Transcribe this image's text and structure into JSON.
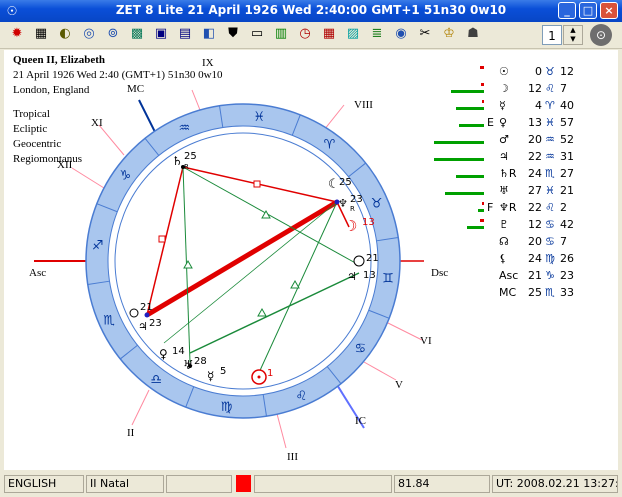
{
  "window": {
    "title": "ZET 8 Lite    21 April 1926  Wed    2:40:00 GMT+1 51n30  0w10",
    "minimize": "_",
    "maximize": "□",
    "close": "×"
  },
  "toolbar": {
    "spinner_value": "1"
  },
  "chart_header": {
    "name": "Queen II, Elizabeth",
    "datetime": "21 April 1926  Wed   2:40 (GMT+1) 51n30  0w10",
    "place": "London, England"
  },
  "chart_system": [
    "Tropical",
    "Ecliptic",
    "Geocentric",
    "Regiomontanus"
  ],
  "axis_labels": {
    "asc": "Asc",
    "dsc": "Dsc",
    "mc": "MC",
    "ic": "IC"
  },
  "house_labels": [
    "II",
    "III",
    "V",
    "VI",
    "VIII",
    "IX",
    "XI",
    "XII"
  ],
  "planet_table": [
    {
      "glyph": "☉",
      "deg": "0",
      "sign": "♉",
      "min": "12",
      "flag": "",
      "bar_green": 0,
      "bar_red": 0.3
    },
    {
      "glyph": "☽",
      "deg": "12",
      "sign": "♌",
      "min": "7",
      "flag": "",
      "bar_green": 0.6,
      "bar_red": 0.2
    },
    {
      "glyph": "☿",
      "deg": "4",
      "sign": "♈",
      "min": "40",
      "flag": "",
      "bar_green": 0.5,
      "bar_red": 0.15
    },
    {
      "glyph": "♀",
      "deg": "13",
      "sign": "♓",
      "min": "57",
      "flag": "E",
      "bar_green": 0.45,
      "bar_red": 0
    },
    {
      "glyph": "♂",
      "deg": "20",
      "sign": "♒",
      "min": "52",
      "flag": "",
      "bar_green": 0.9,
      "bar_red": 0
    },
    {
      "glyph": "♃",
      "deg": "22",
      "sign": "♒",
      "min": "31",
      "flag": "",
      "bar_green": 0.9,
      "bar_red": 0
    },
    {
      "glyph": "♄R",
      "deg": "24",
      "sign": "♏",
      "min": "27",
      "flag": "",
      "bar_green": 0.5,
      "bar_red": 0
    },
    {
      "glyph": "♅",
      "deg": "27",
      "sign": "♓",
      "min": "21",
      "flag": "",
      "bar_green": 0.7,
      "bar_red": 0
    },
    {
      "glyph": "♆R",
      "deg": "22",
      "sign": "♌",
      "min": "2",
      "flag": "F",
      "bar_green": 0.1,
      "bar_red": 0.15
    },
    {
      "glyph": "♇",
      "deg": "12",
      "sign": "♋",
      "min": "42",
      "flag": "",
      "bar_green": 0.3,
      "bar_red": 0.3
    },
    {
      "glyph": "☊",
      "deg": "20",
      "sign": "♋",
      "min": "7",
      "flag": "",
      "bar_green": 0,
      "bar_red": 0
    },
    {
      "glyph": "⚸",
      "deg": "24",
      "sign": "♍",
      "min": "26",
      "flag": "",
      "bar_green": 0,
      "bar_red": 0
    },
    {
      "glyph": "Asc",
      "deg": "21",
      "sign": "♑",
      "min": "23",
      "flag": "",
      "bar_green": 0,
      "bar_red": 0
    },
    {
      "glyph": "MC",
      "deg": "25",
      "sign": "♏",
      "min": "33",
      "flag": "",
      "bar_green": 0,
      "bar_red": 0
    }
  ],
  "wheel_planets": [
    {
      "glyph": "♄",
      "label": "25",
      "sub": "R"
    },
    {
      "glyph": "☾",
      "label": "25"
    },
    {
      "glyph": "♆",
      "label": "23",
      "sub": "R"
    },
    {
      "glyph": "☽",
      "label": "13"
    },
    {
      "glyph": "♀",
      "label": "21"
    },
    {
      "glyph": "♃",
      "label": "13"
    },
    {
      "glyph": "♂",
      "label": "21"
    },
    {
      "glyph": "♃",
      "label": "23"
    },
    {
      "glyph": "♀",
      "label": "14"
    },
    {
      "glyph": "♅",
      "label": "28"
    },
    {
      "glyph": "☿",
      "label": "5"
    },
    {
      "glyph": "☉",
      "label": "1"
    }
  ],
  "statusbar": {
    "language": "ENGLISH",
    "mode": "II Natal",
    "value": "81.84",
    "ut": "UT: 2008.02.21 13:27:43"
  },
  "colors": {
    "ring": "#a9c6ee",
    "ring_border": "#4a7cd2",
    "red_aspect": "#e00000",
    "green_aspect": "#1a8a3a",
    "green_bar": "#00a000",
    "red_bar": "#e00000"
  }
}
